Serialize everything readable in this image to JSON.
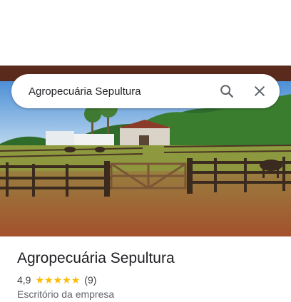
{
  "search": {
    "value": "Agropecuária Sepultura",
    "search_icon": "search-icon",
    "close_icon": "close-icon"
  },
  "place": {
    "name": "Agropecuária Sepultura",
    "rating": "4,9",
    "stars": 5,
    "review_count": "(9)",
    "category": "Escritório da empresa"
  },
  "colors": {
    "star": "#fbbc04",
    "title": "#202124",
    "secondary": "#5f6368"
  }
}
